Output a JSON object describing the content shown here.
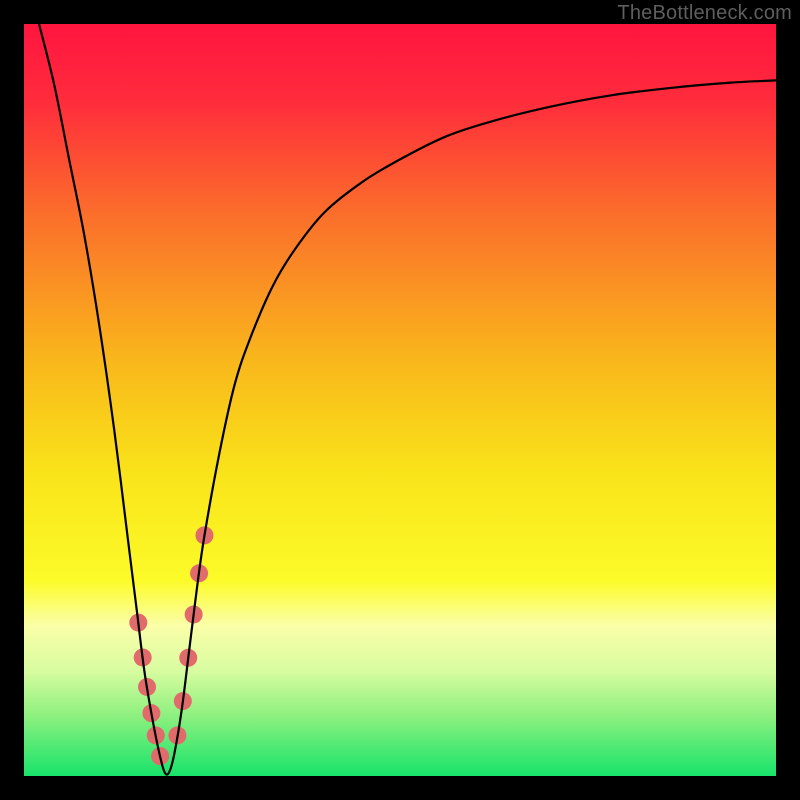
{
  "watermark": "TheBottleneck.com",
  "chart_data": {
    "type": "line",
    "title": "",
    "xlabel": "",
    "ylabel": "",
    "xlim": [
      0,
      100
    ],
    "ylim": [
      0,
      100
    ],
    "background_gradient": {
      "stops": [
        {
          "offset": 0.0,
          "color": "#ff153f"
        },
        {
          "offset": 0.1,
          "color": "#ff2b3c"
        },
        {
          "offset": 0.25,
          "color": "#fb6d2b"
        },
        {
          "offset": 0.45,
          "color": "#f9b81b"
        },
        {
          "offset": 0.6,
          "color": "#f9e41a"
        },
        {
          "offset": 0.74,
          "color": "#fcfb29"
        },
        {
          "offset": 0.8,
          "color": "#fbffa9"
        },
        {
          "offset": 0.86,
          "color": "#d8fca0"
        },
        {
          "offset": 0.92,
          "color": "#8df07f"
        },
        {
          "offset": 1.0,
          "color": "#17e36a"
        }
      ]
    },
    "series": [
      {
        "name": "bottleneck-curve",
        "color": "#000000",
        "x": [
          2,
          4,
          6,
          8,
          10,
          12,
          14,
          15,
          16,
          17,
          18,
          18.7,
          19.3,
          20,
          21,
          22,
          23,
          24,
          26,
          28,
          30,
          33,
          36,
          40,
          45,
          50,
          56,
          62,
          70,
          78,
          86,
          94,
          100
        ],
        "y": [
          100,
          92,
          82,
          72,
          60,
          46,
          30,
          22,
          14,
          8,
          3,
          0.5,
          0.5,
          3,
          9,
          17,
          25,
          32,
          43,
          52,
          58,
          65,
          70,
          75,
          79,
          82,
          85,
          87,
          89,
          90.5,
          91.5,
          92.2,
          92.5
        ]
      }
    ],
    "dot_ranges": {
      "color": "#e16a6a",
      "radius": 9,
      "left": {
        "x_start": 15.2,
        "x_end": 18.1,
        "count": 6
      },
      "right": {
        "x_start": 20.4,
        "x_end": 24.0,
        "count": 6
      }
    }
  }
}
